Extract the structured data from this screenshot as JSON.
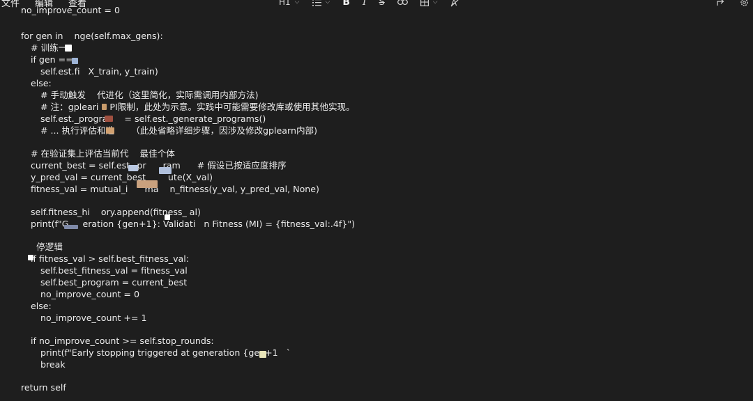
{
  "menu": {
    "file": "文件",
    "edit": "编辑",
    "view": "查看"
  },
  "toolbar": {
    "heading": "H1",
    "list_icon": "list-icon",
    "bold": "B",
    "italic": "I",
    "strike": "S",
    "link_icon": "link-icon",
    "table_icon": "table-icon",
    "clear_format_icon": "clear-format-icon",
    "chevron": "⌵"
  },
  "right_icons": [
    "share-icon",
    "settings-icon"
  ],
  "code_lines": [
    "no_improve_count = 0",
    "",
    "for gen in    nge(self.max_gens):",
    "# 训练一",
    "if gen ==",
    "self.est.fi   X_train, y_train)",
    "else:",
    "# 手动触发    代进化（这里简化，实际需调用内部方法)",
    "# 注：gpleari    PI限制，此处为示意。实践中可能需要修改库或使用其他实现。",
    "self.est._progra      = self.est._generate_programs()",
    "# ... 执行评估和选      （此处省略详细步骤，因涉及修改gplearn内部)",
    "",
    "# 在验证集上评估当前代    最佳个体",
    "current_best = self.est._pr      ram      # 假设已按适应度排序",
    "y_pred_val = current_best        ute(X_val)",
    "fitness_val = mutual_i      ma    n_fitness(y_val, y_pred_val, None)",
    "",
    "self.fitness_hi    ory.append(fitness_ al)",
    "print(f\"G     eration {gen+1}: Validati   n Fitness (MI) = {fitness_val:.4f}\")",
    "",
    "  停逻辑",
    "if fitness_val > self.best_fitness_val:",
    "self.best_fitness_val = fitness_val",
    "self.best_program = current_best",
    "no_improve_count = 0",
    "else:",
    "no_improve_count += 1",
    "",
    "if no_improve_count >= self.stop_rounds:",
    "print(f\"Early stopping triggered at generation {gen+1   `",
    "break",
    "",
    "return self"
  ]
}
